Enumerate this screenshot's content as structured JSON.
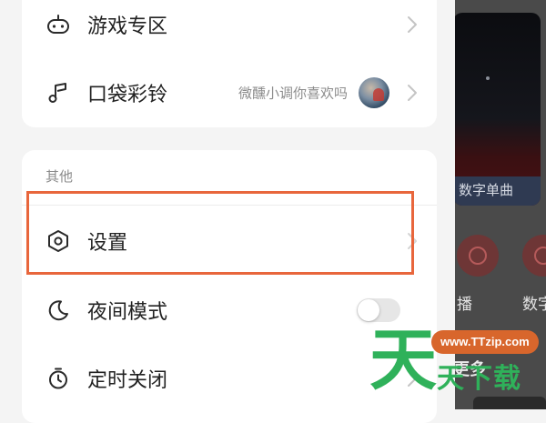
{
  "menu_top": {
    "items": [
      {
        "label": "游戏专区",
        "icon": "gamepad-icon"
      },
      {
        "label": "口袋彩铃",
        "icon": "music-note-icon",
        "subtitle": "微醺小调你喜欢吗"
      }
    ]
  },
  "menu_other": {
    "section_title": "其他",
    "items": [
      {
        "label": "设置",
        "icon": "hexagon-settings-icon"
      },
      {
        "label": "夜间模式",
        "icon": "moon-icon",
        "toggle_on": false
      },
      {
        "label": "定时关闭",
        "icon": "timer-icon"
      }
    ]
  },
  "background_app": {
    "banner_caption": "数字单曲",
    "labels": [
      "播",
      "数字"
    ],
    "section_title": "更多"
  },
  "watermark": {
    "url": "www.TTzip.com",
    "big_char": "天",
    "text": "天下载"
  },
  "colors": {
    "highlight": "#e8663c",
    "watermark_green": "#2fb15a",
    "watermark_orange": "#d8662c"
  }
}
